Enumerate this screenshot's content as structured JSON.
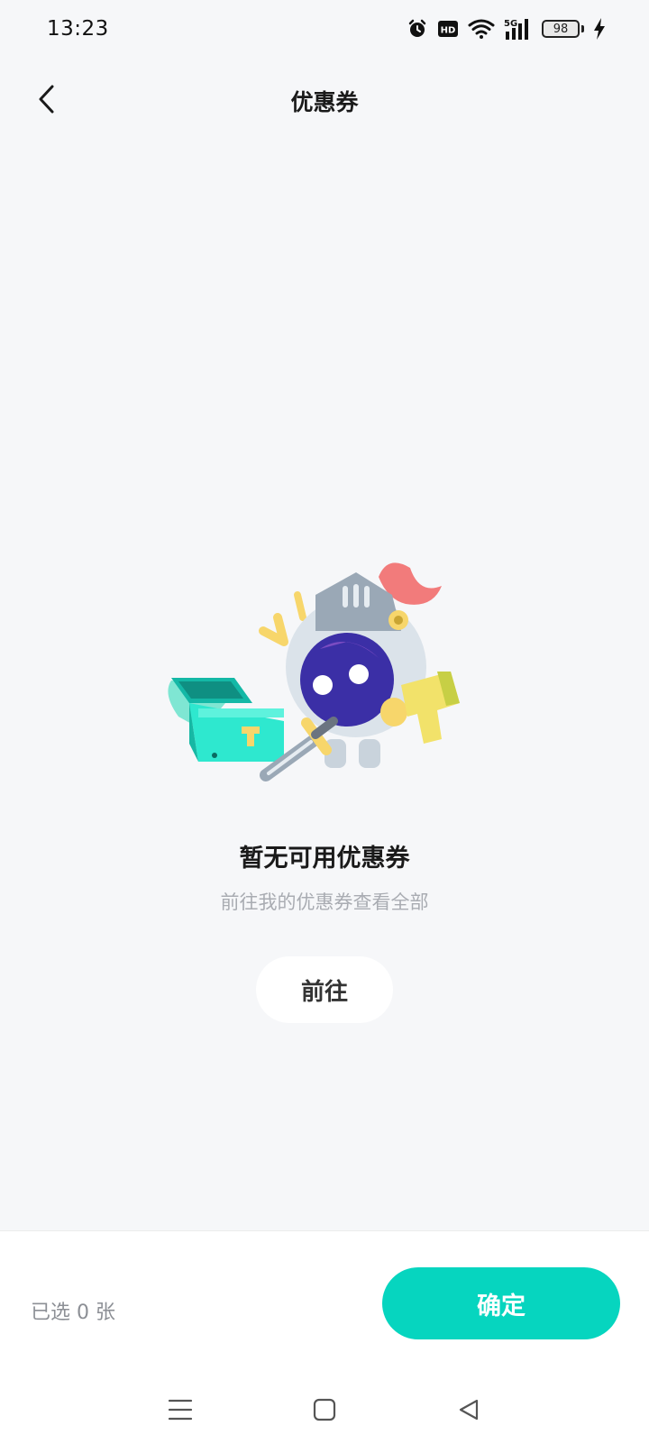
{
  "status_bar": {
    "time": "13:23",
    "battery_level": "98",
    "icons": [
      "alarm-icon",
      "hd-icon",
      "wifi-icon",
      "5g-signal-icon",
      "battery-icon",
      "charging-icon"
    ]
  },
  "header": {
    "title": "优惠券",
    "back_icon": "chevron-left-icon"
  },
  "empty_state": {
    "illustration": "knight-mascot-treasure-chest",
    "title": "暂无可用优惠券",
    "subtitle": "前往我的优惠券查看全部",
    "goto_label": "前往"
  },
  "footer": {
    "selected_text": "已选 0 张",
    "confirm_label": "确定"
  },
  "system_nav": {
    "icons": [
      "menu-icon",
      "home-icon",
      "back-triangle-icon"
    ]
  },
  "colors": {
    "accent": "#06d5bf",
    "background": "#f6f7f9"
  }
}
